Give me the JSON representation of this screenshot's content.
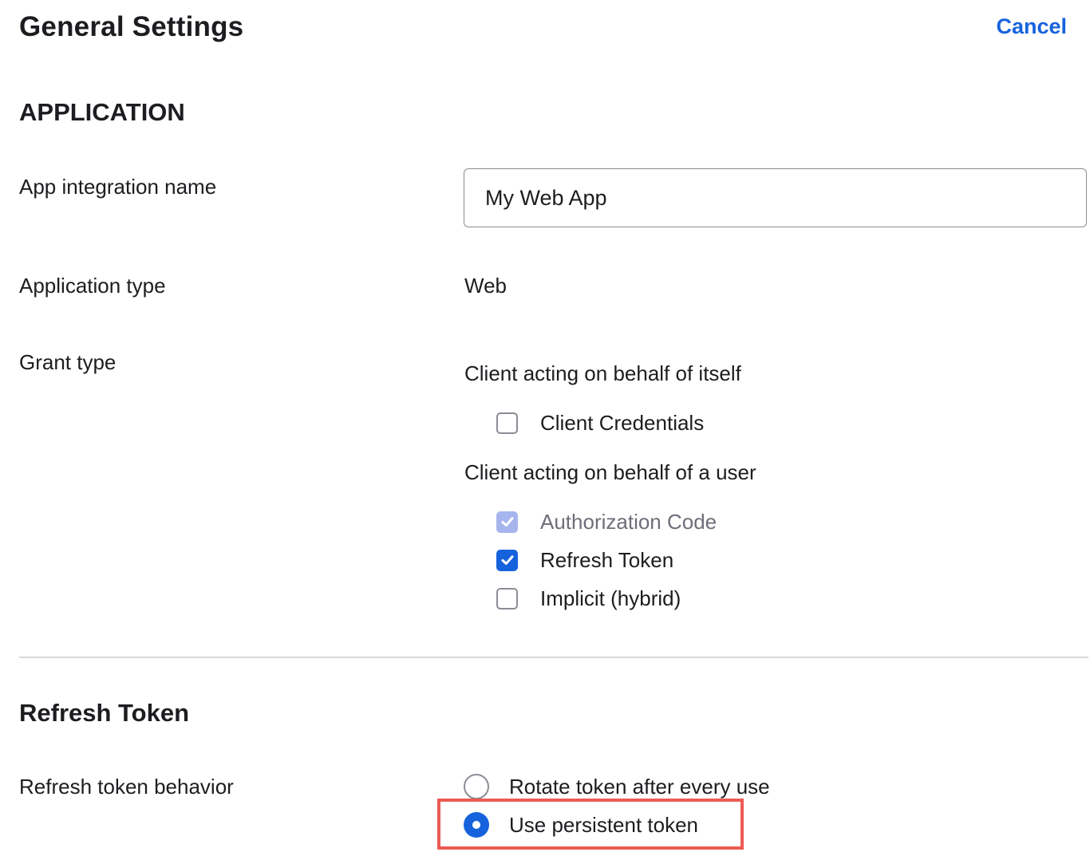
{
  "header": {
    "title": "General Settings",
    "cancel_label": "Cancel"
  },
  "application": {
    "section_title": "APPLICATION",
    "name_label": "App integration name",
    "name_value": "My Web App",
    "type_label": "Application type",
    "type_value": "Web",
    "grant_label": "Grant type",
    "group_itself_label": "Client acting on behalf of itself",
    "group_user_label": "Client acting on behalf of a user",
    "grants": {
      "client_credentials": {
        "label": "Client Credentials",
        "checked": false,
        "disabled": false
      },
      "authorization_code": {
        "label": "Authorization Code",
        "checked": true,
        "disabled": true
      },
      "refresh_token": {
        "label": "Refresh Token",
        "checked": true,
        "disabled": false
      },
      "implicit": {
        "label": "Implicit (hybrid)",
        "checked": false,
        "disabled": false
      }
    }
  },
  "refresh_token": {
    "section_title": "Refresh Token",
    "behavior_label": "Refresh token behavior",
    "options": [
      {
        "label": "Rotate token after every use",
        "selected": false
      },
      {
        "label": "Use persistent token",
        "selected": true
      }
    ]
  },
  "colors": {
    "accent": "#1662dd",
    "highlight": "#ec5a53",
    "disabled_check": "#a7b5ee"
  }
}
